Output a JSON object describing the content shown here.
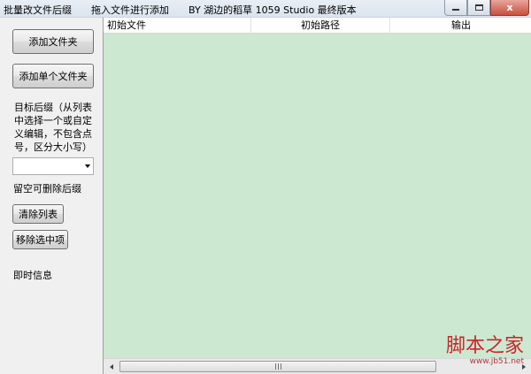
{
  "window": {
    "title": "批量改文件后缀　　拖入文件进行添加　　BY 湖边的稻草 1059 Studio 最终版本",
    "close_label": "x"
  },
  "left_panel": {
    "add_folder_button": "添加文件夹",
    "add_single_folder_button": "添加单个文件夹",
    "suffix_description": "目标后缀（从列表中选择一个或自定义编辑，不包含点号，区分大小写）",
    "suffix_combo_value": "",
    "empty_delete_hint": "留空可删除后缀",
    "clear_list_button": "清除列表",
    "remove_selected_button": "移除选中项",
    "instant_info_label": "即时信息"
  },
  "list": {
    "columns": [
      "初始文件",
      "初始路径",
      "输出"
    ],
    "rows": [],
    "background_color": "#cde8d0"
  },
  "scrollbar": {
    "grip_icon": "scroll-grip-icon"
  },
  "watermark": {
    "text": "脚本之家",
    "url": "www.jb51.net"
  }
}
